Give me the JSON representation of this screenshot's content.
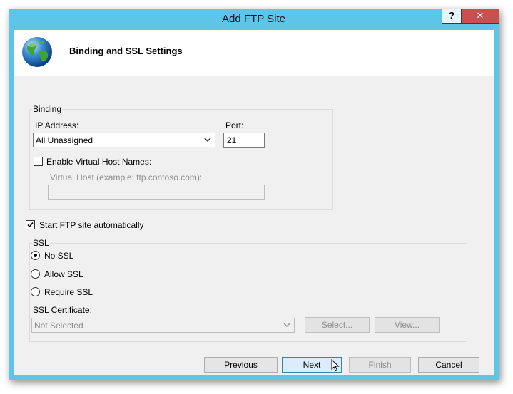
{
  "window": {
    "title": "Add FTP Site",
    "help_label": "?",
    "close_label": "✕"
  },
  "header": {
    "title": "Binding and SSL Settings",
    "icon": "globe-icon"
  },
  "binding": {
    "group_label": "Binding",
    "ip_label": "IP Address:",
    "ip_value": "All Unassigned",
    "port_label": "Port:",
    "port_value": "21",
    "virtual_host_checkbox_label": "Enable Virtual Host Names:",
    "virtual_host_checked": false,
    "virtual_host_label": "Virtual Host (example: ftp.contoso.com):",
    "virtual_host_value": ""
  },
  "start_ftp": {
    "label": "Start FTP site automatically",
    "checked": true
  },
  "ssl": {
    "group_label": "SSL",
    "options": [
      {
        "label": "No SSL",
        "selected": true
      },
      {
        "label": "Allow SSL",
        "selected": false
      },
      {
        "label": "Require SSL",
        "selected": false
      }
    ],
    "certificate_label": "SSL Certificate:",
    "certificate_value": "Not Selected",
    "select_button": "Select...",
    "view_button": "View..."
  },
  "footer": {
    "previous": "Previous",
    "next": "Next",
    "finish": "Finish",
    "cancel": "Cancel"
  }
}
